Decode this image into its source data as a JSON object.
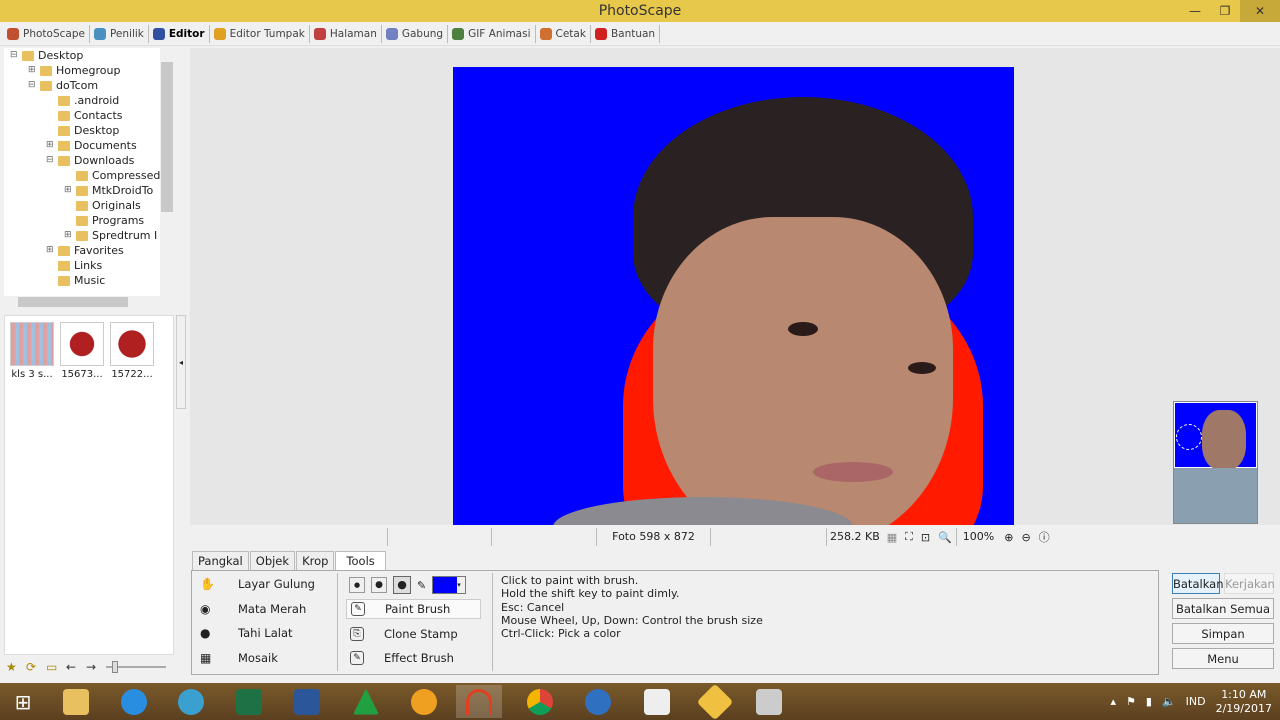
{
  "window": {
    "title": "PhotoScape"
  },
  "menu": [
    {
      "label": "PhotoScape",
      "color": "#c05030"
    },
    {
      "label": "Penilik",
      "color": "#4a90c0"
    },
    {
      "label": "Editor",
      "color": "#3050a0",
      "active": true
    },
    {
      "label": "Editor Tumpak",
      "color": "#e0a020"
    },
    {
      "label": "Halaman",
      "color": "#c04040"
    },
    {
      "label": "Gabung",
      "color": "#7080c0"
    },
    {
      "label": "GIF Animasi",
      "color": "#508040"
    },
    {
      "label": "Cetak",
      "color": "#d07030"
    },
    {
      "label": "Bantuan",
      "color": "#d02020"
    }
  ],
  "tree": [
    {
      "label": "Desktop",
      "level": 0,
      "expander": "-"
    },
    {
      "label": "Homegroup",
      "level": 1,
      "expander": "+"
    },
    {
      "label": "doTcom",
      "level": 1,
      "expander": "-"
    },
    {
      "label": ".android",
      "level": 2,
      "expander": ""
    },
    {
      "label": "Contacts",
      "level": 2,
      "expander": ""
    },
    {
      "label": "Desktop",
      "level": 2,
      "expander": ""
    },
    {
      "label": "Documents",
      "level": 2,
      "expander": "+"
    },
    {
      "label": "Downloads",
      "level": 2,
      "expander": "-"
    },
    {
      "label": "Compressed",
      "level": 3,
      "expander": ""
    },
    {
      "label": "MtkDroidTo",
      "level": 3,
      "expander": "+"
    },
    {
      "label": "Originals",
      "level": 3,
      "expander": ""
    },
    {
      "label": "Programs",
      "level": 3,
      "expander": ""
    },
    {
      "label": "Spredtrum I",
      "level": 3,
      "expander": "+"
    },
    {
      "label": "Favorites",
      "level": 2,
      "expander": "+"
    },
    {
      "label": "Links",
      "level": 2,
      "expander": ""
    },
    {
      "label": "Music",
      "level": 2,
      "expander": ""
    }
  ],
  "thumbnails": [
    {
      "label": "kls 3 s..."
    },
    {
      "label": "15673..."
    },
    {
      "label": "15722..."
    }
  ],
  "status": {
    "dimensions": "Foto 598 x 872",
    "filesize": "258.2 KB",
    "zoom": "100%"
  },
  "tabs": [
    {
      "label": "Pangkal"
    },
    {
      "label": "Objek"
    },
    {
      "label": "Krop"
    },
    {
      "label": "Tools",
      "active": true
    }
  ],
  "tools_left": [
    {
      "label": "Layar Gulung",
      "icon": "hand-icon"
    },
    {
      "label": "Mata Merah",
      "icon": "red-eye-icon"
    },
    {
      "label": "Tahi Lalat",
      "icon": "mole-icon"
    },
    {
      "label": "Mosaik",
      "icon": "mosaic-icon"
    }
  ],
  "tools_right": [
    {
      "label": "Paint Brush",
      "icon": "brush-icon",
      "active": true
    },
    {
      "label": "Clone Stamp",
      "icon": "stamp-icon"
    },
    {
      "label": "Effect Brush",
      "icon": "effect-brush-icon"
    }
  ],
  "brush_color": "#0000ff",
  "help": [
    "Click to paint with brush.",
    "Hold the shift key to paint dimly.",
    "Esc: Cancel",
    "Mouse Wheel, Up, Down: Control the brush size",
    "Ctrl-Click: Pick a color"
  ],
  "buttons": {
    "undo": "Batalkan",
    "redo": "Kerjakan",
    "undo_all": "Batalkan Semua",
    "save": "Simpan",
    "menu": "Menu"
  },
  "tray": {
    "language": "IND",
    "time": "1:10 AM",
    "date": "2/19/2017"
  }
}
